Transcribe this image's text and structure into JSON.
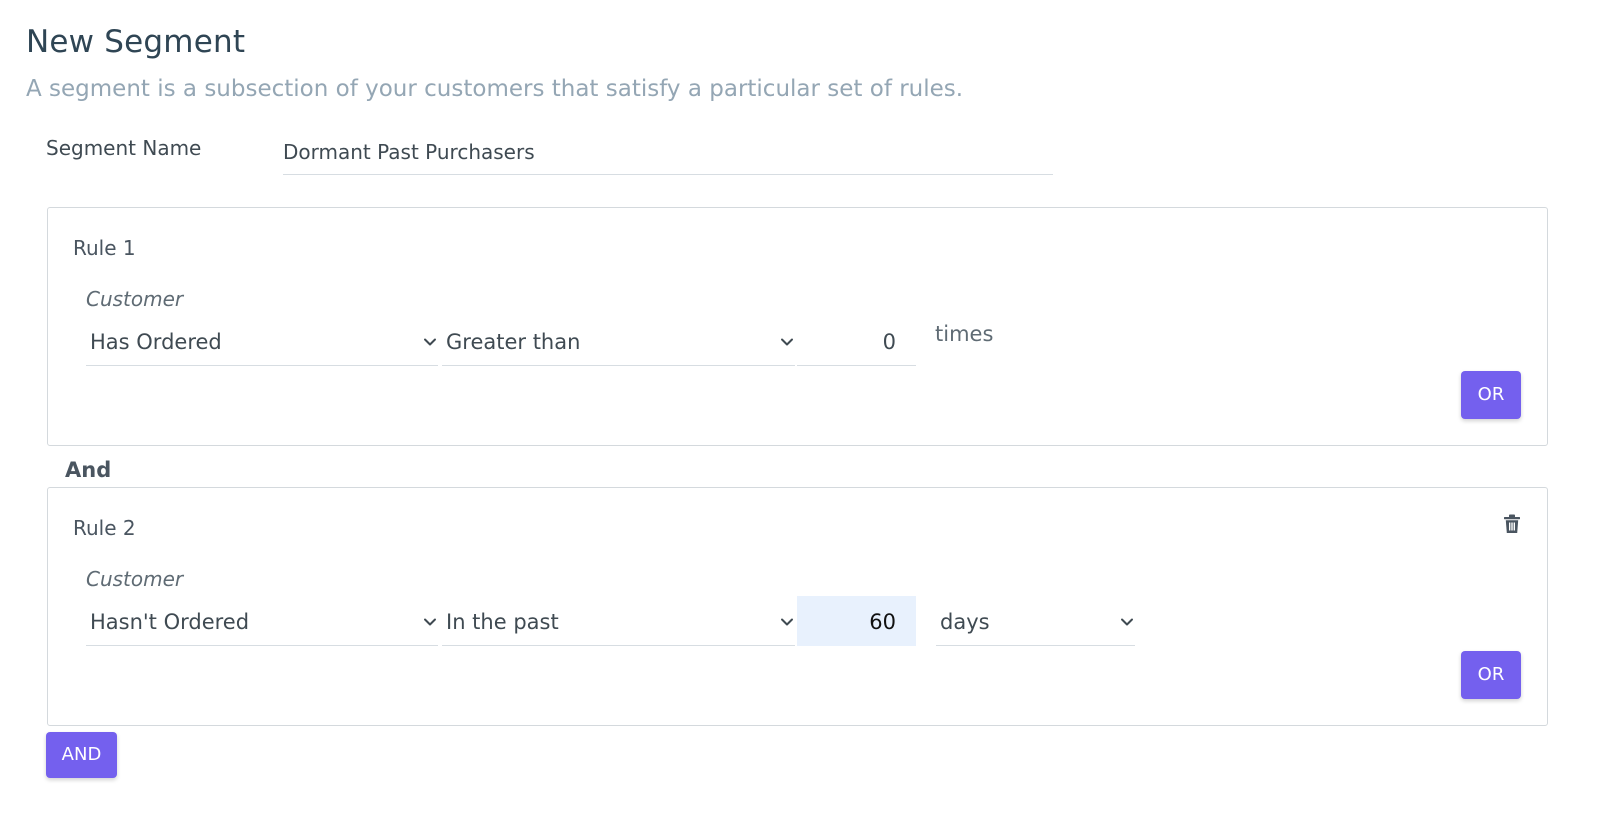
{
  "header": {
    "title": "New Segment",
    "subtitle": "A segment is a subsection of your customers that satisfy a particular set of rules."
  },
  "segment": {
    "name_label": "Segment Name",
    "name_value": "Dormant Past Purchasers"
  },
  "rules": [
    {
      "title": "Rule 1",
      "field_label": "Customer",
      "condition": "Has Ordered",
      "operator": "Greater than",
      "value": "0",
      "unit": "times",
      "or_label": "OR"
    },
    {
      "title": "Rule 2",
      "field_label": "Customer",
      "condition": "Hasn't Ordered",
      "operator": "In the past",
      "value": "60",
      "unit": "days",
      "or_label": "OR",
      "delete_icon": "trash-icon"
    }
  ],
  "and_separator": "And",
  "and_button_label": "AND",
  "colors": {
    "accent": "#7460ee",
    "focus_bg": "#e8f1fd",
    "title": "#2f4554",
    "subtitle": "#94a6b4"
  }
}
